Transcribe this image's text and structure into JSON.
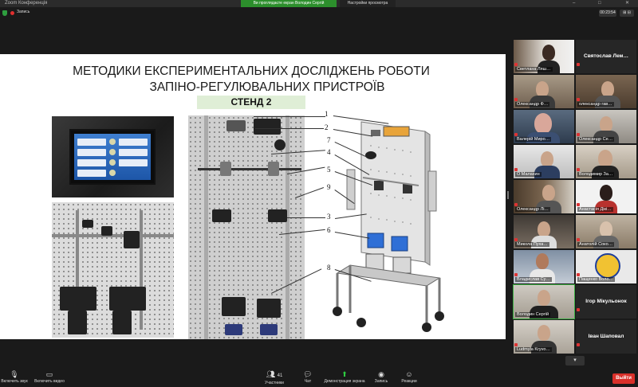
{
  "titlebar": {
    "app": "Zoom Конференція",
    "share_banner": "Ви проглядаєте екран Володин Сергій",
    "view_options": "Настройки просмотра",
    "win_min": "–",
    "win_max": "□",
    "win_close": "✕"
  },
  "topbar": {
    "rec_label": "Запись",
    "timer": "00:23:54",
    "layout_btn": "⊞ ⊟"
  },
  "slide": {
    "title_line1": "МЕТОДИКИ ЕКСПЕРИМЕНТАЛЬНИХ ДОСЛІДЖЕНЬ РОБОТИ",
    "title_line2": "ЗАПІНО-РЕГУЛЮВАЛЬНИХ ПРИСТРОЇВ",
    "stend": "СТЕНД 2",
    "callouts": [
      "1",
      "2",
      "7",
      "4",
      "5",
      "9",
      "3",
      "6",
      "8"
    ]
  },
  "participants": [
    {
      "name": "Светлана Ляш…",
      "type": "video"
    },
    {
      "name": "Святослав Лем…",
      "type": "name"
    },
    {
      "name": "Олександр Ф…",
      "type": "video"
    },
    {
      "name": "олександр гав…",
      "type": "video"
    },
    {
      "name": "Валерій Миро…",
      "type": "video"
    },
    {
      "name": "Олександр Се…",
      "type": "video"
    },
    {
      "name": "О Малахин",
      "type": "video"
    },
    {
      "name": "Володимир За…",
      "type": "video"
    },
    {
      "name": "Олександр Лі…",
      "type": "video"
    },
    {
      "name": "Анастасія Дікі…",
      "type": "video"
    },
    {
      "name": "Микола Пуха…",
      "type": "video"
    },
    {
      "name": "Анатолій Соко…",
      "type": "video"
    },
    {
      "name": "Владислав Су…",
      "type": "video"
    },
    {
      "name": "Пащенко Воло…",
      "type": "video"
    },
    {
      "name": "Володин Сергій",
      "type": "video"
    },
    {
      "name": "Ігор Мікульонок",
      "type": "name"
    },
    {
      "name": "Ludmyla Kryvo…",
      "type": "video"
    },
    {
      "name": "Іван Шаповал",
      "type": "name"
    }
  ],
  "toolbar": {
    "mic": "Включить звук",
    "video": "Включить видео",
    "participants": "Участники",
    "participants_count": "41",
    "chat": "Чат",
    "share": "Демонстрация экрана",
    "record": "Запись",
    "reactions": "Реакции",
    "leave": "Выйти"
  },
  "colors": {
    "share_green": "#2c8f2c",
    "leave_red": "#d9302a",
    "active_outline": "#3cb043"
  }
}
